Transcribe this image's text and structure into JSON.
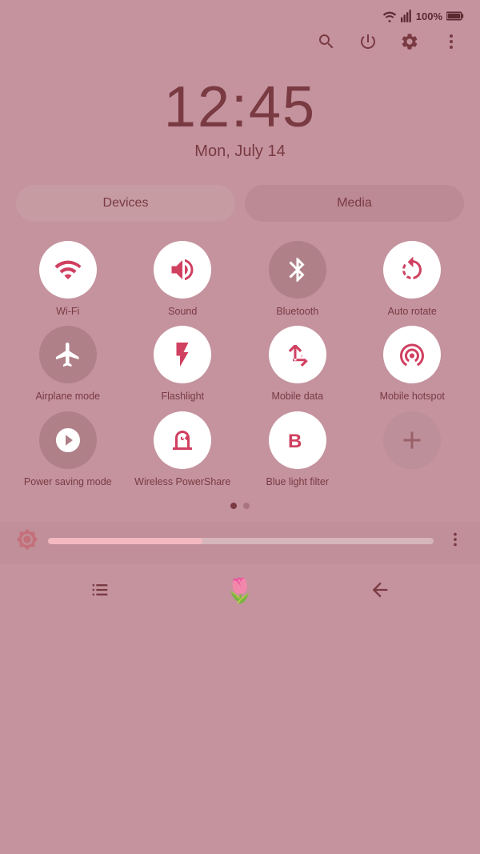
{
  "statusBar": {
    "battery": "100%",
    "wifi": "wifi",
    "signal": "signal"
  },
  "topActions": {
    "search": "search",
    "power": "power",
    "settings": "settings",
    "more": "more"
  },
  "clock": {
    "time": "12:45",
    "date": "Mon, July 14"
  },
  "tabs": [
    {
      "id": "devices",
      "label": "Devices",
      "active": true
    },
    {
      "id": "media",
      "label": "Media",
      "active": false
    }
  ],
  "tiles": [
    {
      "id": "wifi",
      "label": "Wi-Fi",
      "active": true
    },
    {
      "id": "sound",
      "label": "Sound",
      "active": true
    },
    {
      "id": "bluetooth",
      "label": "Bluetooth",
      "active": false
    },
    {
      "id": "autorotate",
      "label": "Auto\nrotate",
      "active": true
    },
    {
      "id": "airplane",
      "label": "Airplane\nmode",
      "active": false
    },
    {
      "id": "flashlight",
      "label": "Flashlight",
      "active": true
    },
    {
      "id": "mobiledata",
      "label": "Mobile\ndata",
      "active": true
    },
    {
      "id": "mobilehotspot",
      "label": "Mobile\nhotspot",
      "active": true
    },
    {
      "id": "powersaving",
      "label": "Power saving\nmode",
      "active": false
    },
    {
      "id": "wirelesspowershare",
      "label": "Wireless\nPowerShare",
      "active": true
    },
    {
      "id": "bluelightfilter",
      "label": "Blue light\nfilter",
      "active": true
    },
    {
      "id": "add",
      "label": "",
      "active": false
    }
  ],
  "pageDots": [
    true,
    false
  ],
  "brightness": {
    "fill": 40,
    "moreOptions": "more-options"
  },
  "bottomNav": {
    "recent": "recent-apps",
    "home": "home",
    "back": "back"
  }
}
